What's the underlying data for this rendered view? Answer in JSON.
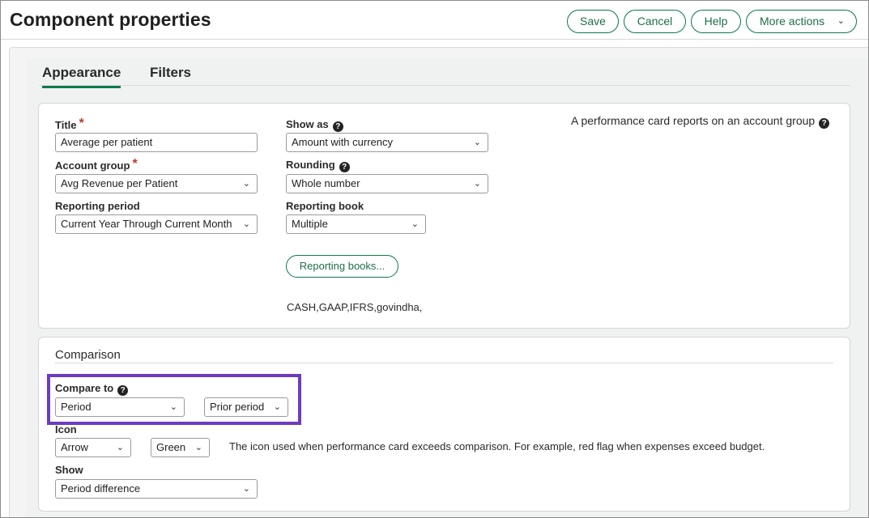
{
  "header": {
    "title": "Component properties",
    "save_label": "Save",
    "cancel_label": "Cancel",
    "help_label": "Help",
    "more_actions_label": "More actions"
  },
  "tabs": [
    {
      "label": "Appearance",
      "active": true
    },
    {
      "label": "Filters",
      "active": false
    }
  ],
  "appearance": {
    "title_label": "Title",
    "title_value": "Average per patient",
    "account_group_label": "Account group",
    "account_group_value": "Avg Revenue per Patient",
    "reporting_period_label": "Reporting period",
    "reporting_period_value": "Current Year Through Current Month",
    "show_as_label": "Show as",
    "show_as_value": "Amount with currency",
    "rounding_label": "Rounding",
    "rounding_value": "Whole number",
    "reporting_book_label": "Reporting book",
    "reporting_book_value": "Multiple",
    "reporting_books_button": "Reporting books...",
    "reporting_books_list": "CASH,GAAP,IFRS,govindha,",
    "info_text": "A performance card reports on an account group"
  },
  "comparison": {
    "section_title": "Comparison",
    "compare_to_label": "Compare to",
    "compare_to_value": "Period",
    "compare_period_value": "Prior period",
    "icon_label": "Icon",
    "icon_value": "Arrow",
    "icon_color_value": "Green",
    "icon_help_text": "The icon used when performance card exceeds comparison. For example, red flag when expenses exceed budget.",
    "show_label": "Show",
    "show_value": "Period difference"
  },
  "colors": {
    "accent": "#0a7a4b",
    "highlight": "#6c3cc0",
    "required": "#c0392b"
  }
}
